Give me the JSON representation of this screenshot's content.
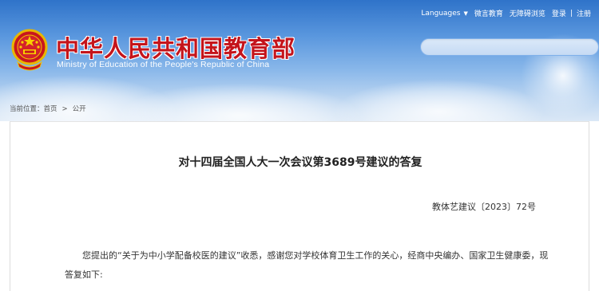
{
  "header": {
    "title": "中华人民共和国教育部",
    "subtitle": "Ministry of Education of the People's Republic of China",
    "top_links": {
      "language": "Languages",
      "weibo": "微言教育",
      "accessible": "无障碍浏览",
      "login": "登录",
      "separator": "|",
      "register": "注册"
    },
    "search": {
      "placeholder": ""
    }
  },
  "breadcrumb": {
    "prefix": "当前位置：",
    "items": [
      "首页",
      "公开"
    ],
    "arrow": ">"
  },
  "article": {
    "title": "对十四届全国人大一次会议第3689号建议的答复",
    "doc_number": "教体艺建议〔2023〕72号",
    "body": "您提出的“关于为中小学配备校医的建议”收悉，感谢您对学校体育卫生工作的关心，经商中央编办、国家卫生健康委，现答复如下:"
  },
  "colors": {
    "header_top": "#2f73c9",
    "title_red": "#c4141b",
    "text": "#333333"
  }
}
